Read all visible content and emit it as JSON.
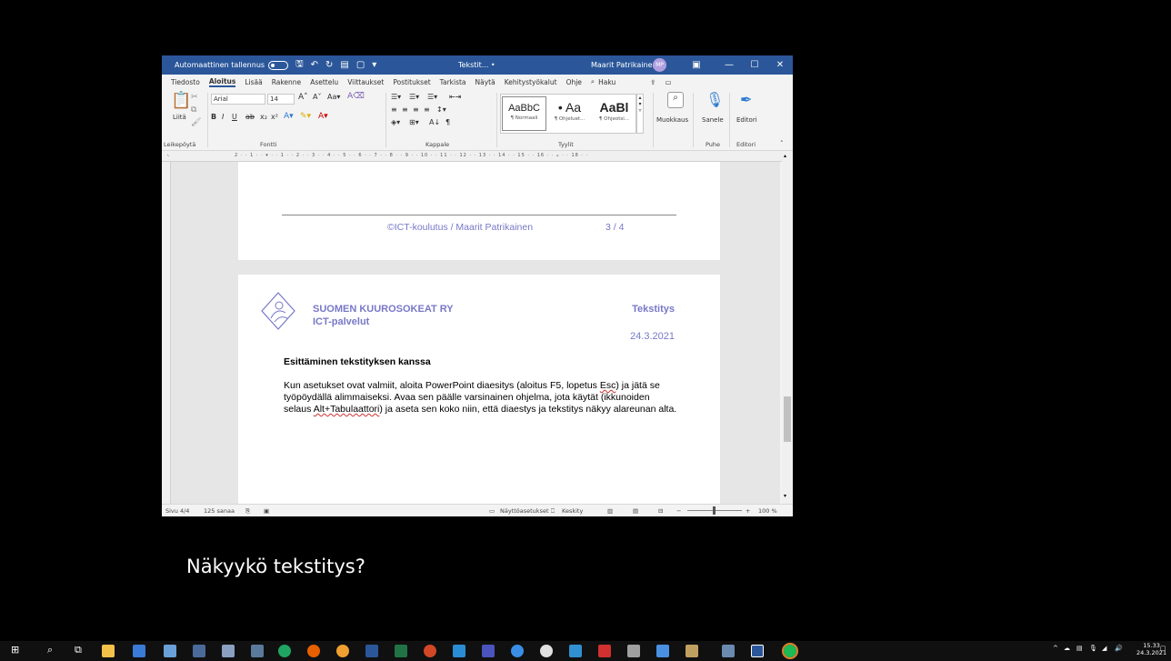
{
  "titlebar": {
    "autosave_label": "Automaattinen tallennus",
    "doc_title": "Tekstit...  •",
    "user_name": "Maarit Patrikainen",
    "avatar_initials": "MP"
  },
  "menu": {
    "items": [
      "Tiedosto",
      "Aloitus",
      "Lisää",
      "Rakenne",
      "Asettelu",
      "Viittaukset",
      "Postitukset",
      "Tarkista",
      "Näytä",
      "Kehitystyökalut",
      "Ohje"
    ],
    "search": "Haku"
  },
  "ribbon": {
    "font_name": "Arial",
    "font_size": "14",
    "paste_label": "Liitä",
    "groups": {
      "clipboard": "Leikepöytä",
      "font": "Fontti",
      "paragraph": "Kappale",
      "styles": "Tyylit",
      "voice": "Puhe",
      "editor": "Editori"
    },
    "styles": [
      {
        "sample": "AaBbC",
        "name": "¶ Normaali"
      },
      {
        "sample": "• Aa",
        "name": "¶ Ohjeluet..."
      },
      {
        "sample": "AaBl",
        "name": "¶ Ohjeotsi..."
      }
    ],
    "edit_label": "Muokkaus",
    "dictate_label": "Sanele",
    "editor_label": "Editori"
  },
  "document": {
    "footer_text": "©ICT-koulutus / Maarit Patrikainen",
    "page_number": "3 / 4",
    "org_name": "SUOMEN KUUROSOKEAT RY",
    "org_sub": "ICT-palvelut",
    "doc_label": "Tekstitys",
    "doc_date": "24.3.2021",
    "heading": "Esittäminen tekstityksen kanssa",
    "para_1": "Kun asetukset ovat valmiit, aloita PowerPoint diaesitys (aloitus F5, lopetus ",
    "para_esc": "Esc",
    "para_2": ") ja jätä se työpöydällä alimmaiseksi. Avaa sen päälle varsinainen ohjelma, jota käytät (ikkunoiden selaus ",
    "para_alt": "Alt+Tabulaattori",
    "para_3": ") ja aseta sen koko niin, että diaestys ja tekstitys näkyy alareunan alta."
  },
  "statusbar": {
    "page": "Sivu 4/4",
    "words": "125 sanaa",
    "display_settings": "Näyttöasetukset",
    "focus": "Keskity",
    "zoom": "100 %"
  },
  "caption": "Näkyykö tekstitys?",
  "clock": {
    "time": "15.33",
    "date": "24.3.2021"
  },
  "colors": {
    "word_blue": "#2b579a",
    "doc_accent": "#7878c8"
  }
}
